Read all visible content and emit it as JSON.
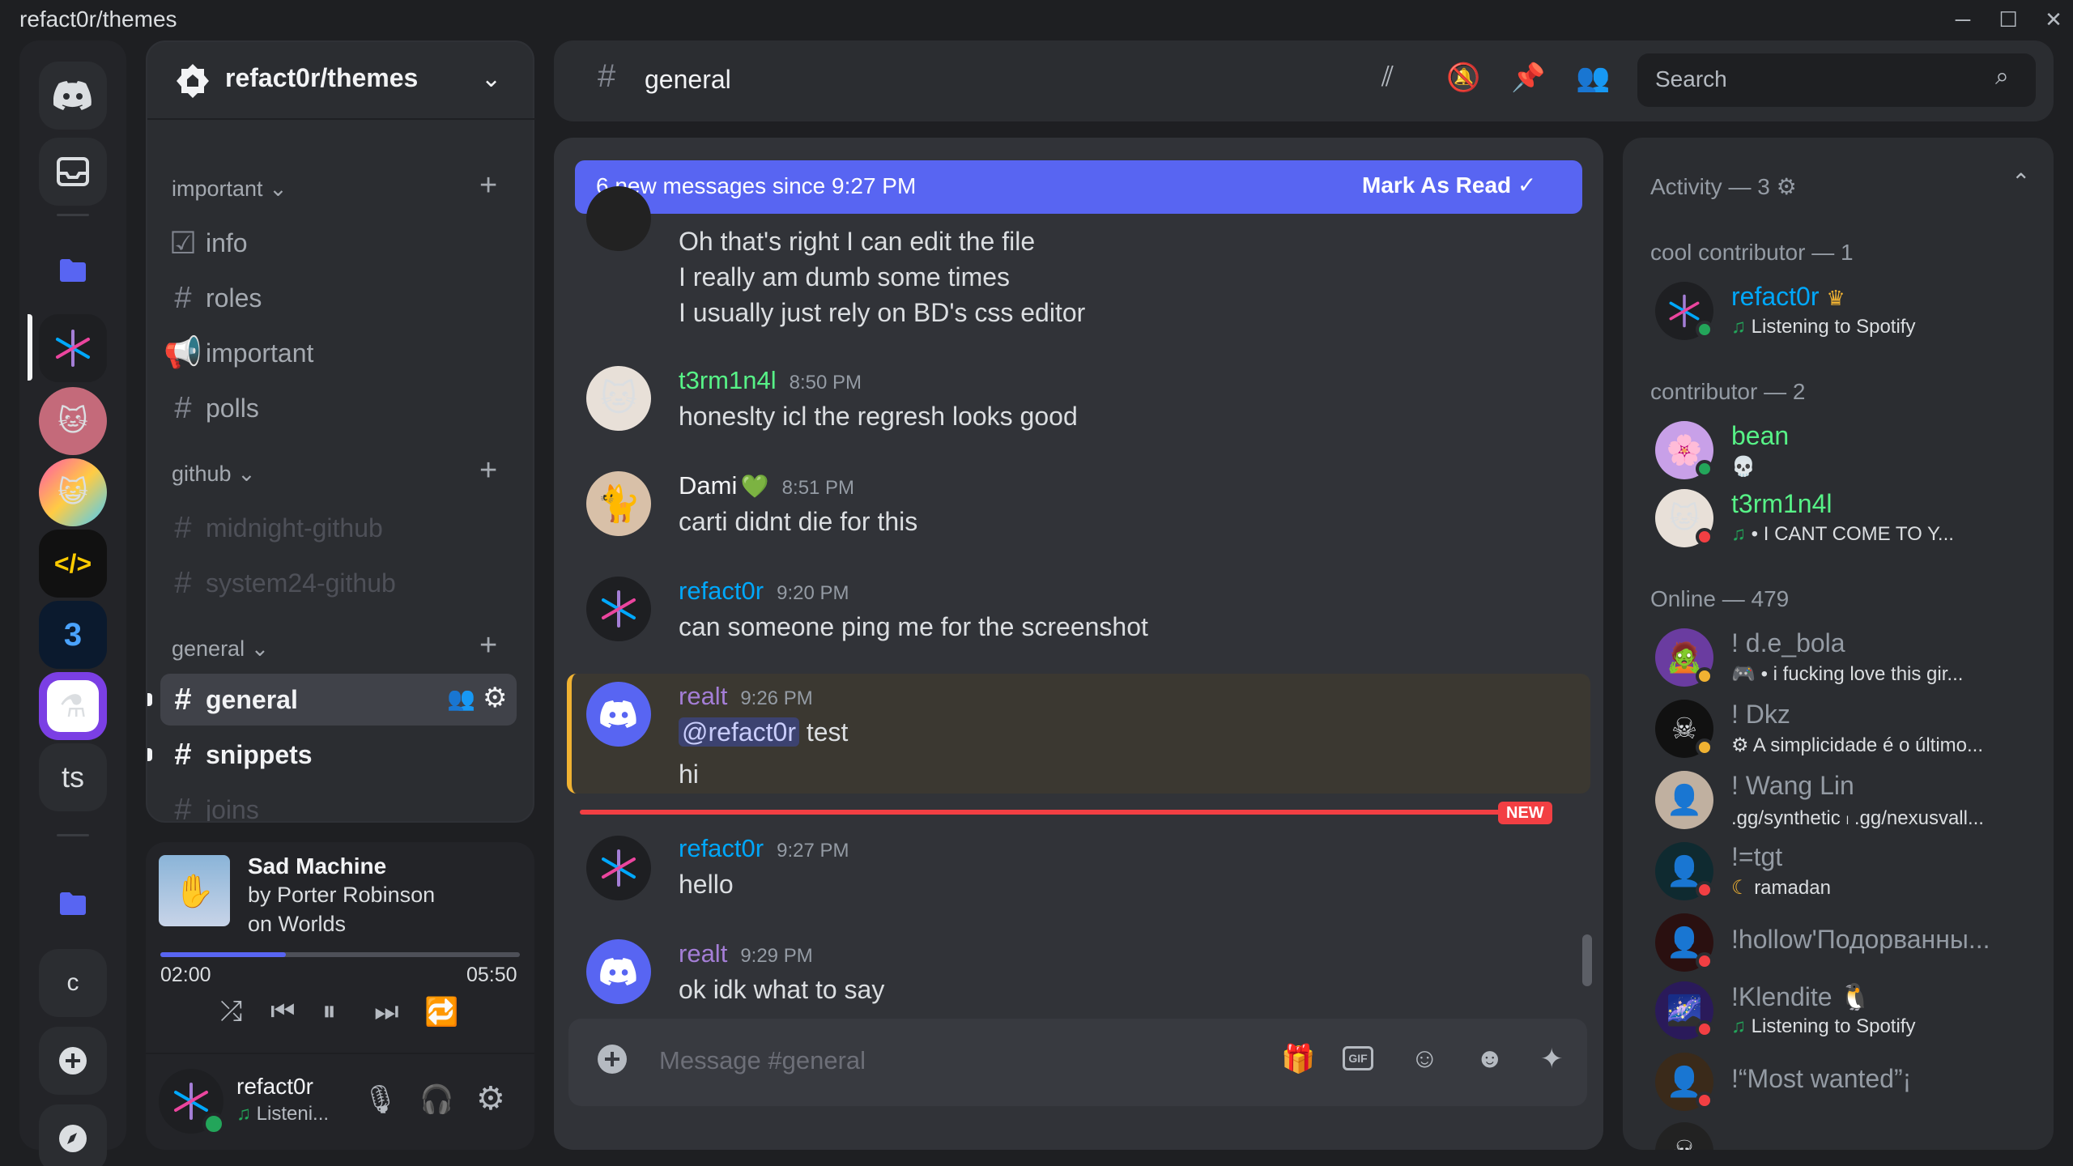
{
  "window": {
    "title": "refact0r/themes"
  },
  "guilds": {
    "items": [
      "discord-home",
      "inbox",
      "folder-blue",
      "refact0r-server",
      "anime-avatar",
      "cat-avatar",
      "code-server",
      "3-server",
      "lab-server",
      "ts",
      "folder-blue-2",
      "c",
      "add-server",
      "discover"
    ],
    "ts_label": "ts",
    "c_label": "c"
  },
  "server": {
    "name": "refact0r/themes"
  },
  "categories": {
    "important": {
      "label": "important"
    },
    "github": {
      "label": "github"
    },
    "general": {
      "label": "general"
    }
  },
  "channels": {
    "info": "info",
    "roles": "roles",
    "important": "important",
    "polls": "polls",
    "midnight_github": "midnight-github",
    "system24_github": "system24-github",
    "general": "general",
    "snippets": "snippets",
    "joins": "joins"
  },
  "player": {
    "title": "Sad Machine",
    "artist": "by Porter Robinson",
    "album": "on Worlds",
    "elapsed": "02:00",
    "duration": "05:50",
    "progress": 0.35
  },
  "user": {
    "name": "refact0r",
    "status": "Listeni..."
  },
  "header": {
    "channel": "general",
    "search_placeholder": "Search"
  },
  "banner": {
    "text": "6 new messages since 9:27 PM",
    "action": "Mark As Read"
  },
  "messages": [
    {
      "lines": [
        "Oh that's right I can edit the file",
        "I really am dumb some times",
        "I usually just rely on BD's css editor"
      ]
    },
    {
      "author": "t3rm1n4l",
      "time": "8:50 PM",
      "text": "honeslty icl the regresh looks good",
      "color": "#57f287"
    },
    {
      "author": "Dami",
      "time": "8:51 PM",
      "text": "carti didnt die for this",
      "color": "#f2f3f5"
    },
    {
      "author": "refact0r",
      "time": "9:20 PM",
      "text": "can someone ping me for the screenshot",
      "color": "#00a8fc"
    },
    {
      "author": "realt",
      "time": "9:26 PM",
      "mention": "@refact0r",
      "text": "test",
      "text2": "hi",
      "color": "#a47ed6"
    },
    {
      "author": "refact0r",
      "time": "9:27 PM",
      "text": "hello",
      "color": "#00a8fc"
    },
    {
      "author": "realt",
      "time": "9:29 PM",
      "text": "ok idk what to say",
      "color": "#a47ed6"
    }
  ],
  "new_divider": {
    "label": "NEW"
  },
  "composer": {
    "placeholder": "Message #general"
  },
  "members": {
    "activity_header": "Activity — 3",
    "groups": [
      {
        "header": "cool contributor — 1",
        "members": [
          {
            "name": "refact0r",
            "activity": "Listening to Spotify",
            "color": "#00a8fc"
          }
        ]
      },
      {
        "header": "contributor — 2",
        "members": [
          {
            "name": "bean",
            "activity": "",
            "color": "#57f287"
          },
          {
            "name": "t3rm1n4l",
            "activity": "• I CANT COME TO Y...",
            "color": "#57f287"
          }
        ]
      },
      {
        "header": "Online — 479",
        "members": [
          {
            "name": "! d.e_bola",
            "activity": "• i fucking love this gir..."
          },
          {
            "name": "! Dkz",
            "activity": "A simplicidade é o último..."
          },
          {
            "name": "! Wang Lin",
            "activity": ".gg/synthetic ၊ .gg/nexusvall..."
          },
          {
            "name": "!=tgt",
            "activity": "ramadan"
          },
          {
            "name": "!hollow'Подорванны...",
            "activity": ""
          },
          {
            "name": "!Klendite",
            "activity": "Listening to Spotify"
          },
          {
            "name": "!“Most wanted”¡",
            "activity": ""
          }
        ]
      }
    ]
  },
  "colors": {
    "accent": "#5865f2",
    "new": "#f23f43",
    "online": "#23a55a",
    "dnd": "#f23f43"
  }
}
